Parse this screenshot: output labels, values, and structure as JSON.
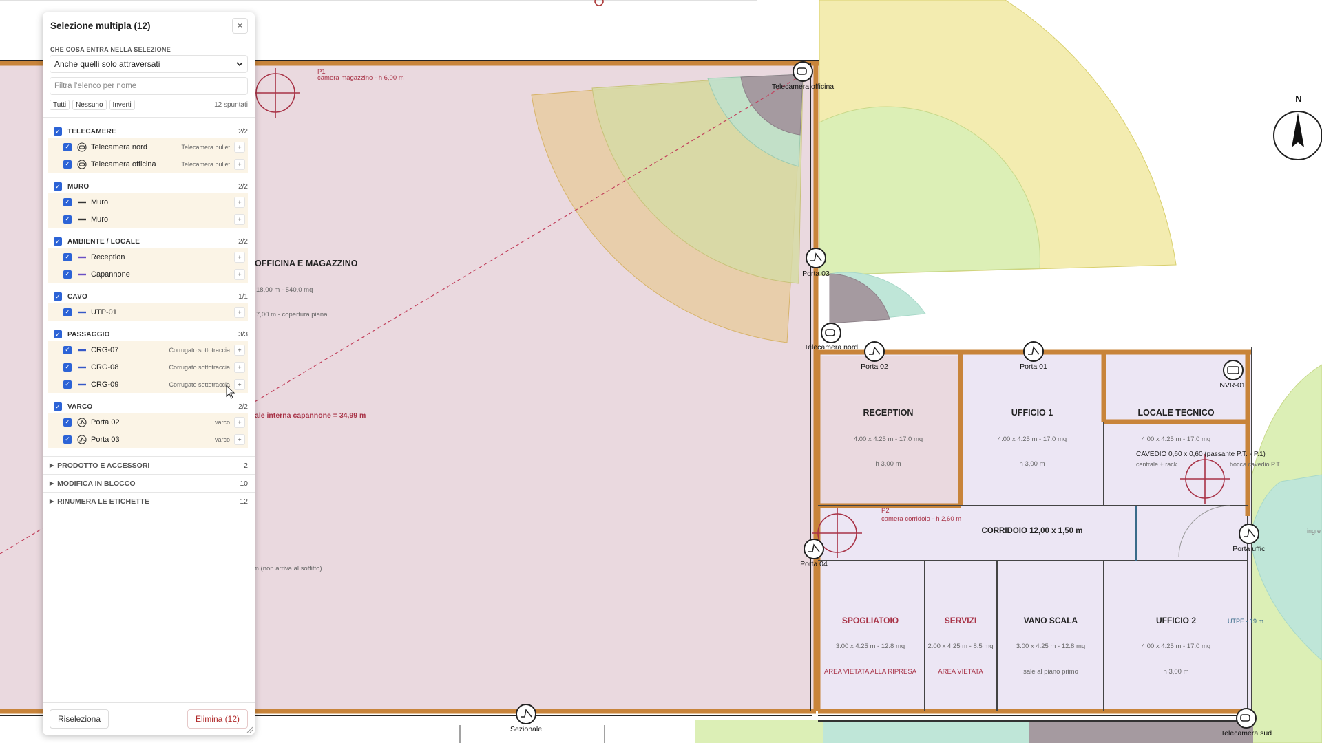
{
  "panel": {
    "title": "Selezione multipla (12)",
    "close_label": "×",
    "mode_label": "CHE COSA ENTRA NELLA SELEZIONE",
    "mode_value": "Anche quelli solo attraversati",
    "filter_placeholder": "Filtra l'elenco per nome",
    "btn_all": "Tutti",
    "btn_none": "Nessuno",
    "btn_invert": "Inverti",
    "checked_count": "12 spuntati",
    "groups": [
      {
        "name": "TELECAMERE",
        "count": "2/2",
        "items": [
          {
            "label": "Telecamera nord",
            "sub": "Telecamera bullet",
            "icon": "camera-icon"
          },
          {
            "label": "Telecamera officina",
            "sub": "Telecamera bullet",
            "icon": "camera-icon"
          }
        ]
      },
      {
        "name": "MURO",
        "count": "2/2",
        "items": [
          {
            "label": "Muro",
            "sub": "",
            "icon": "wall-line-icon"
          },
          {
            "label": "Muro",
            "sub": "",
            "icon": "wall-line-icon"
          }
        ]
      },
      {
        "name": "AMBIENTE / LOCALE",
        "count": "2/2",
        "items": [
          {
            "label": "Reception",
            "sub": "",
            "icon": "room-line-icon"
          },
          {
            "label": "Capannone",
            "sub": "",
            "icon": "room-line-icon"
          }
        ]
      },
      {
        "name": "CAVO",
        "count": "1/1",
        "items": [
          {
            "label": "UTP-01",
            "sub": "",
            "icon": "cable-line-icon"
          }
        ]
      },
      {
        "name": "PASSAGGIO",
        "count": "3/3",
        "items": [
          {
            "label": "CRG-07",
            "sub": "Corrugato sottotraccia",
            "icon": "conduit-line-icon"
          },
          {
            "label": "CRG-08",
            "sub": "Corrugato sottotraccia",
            "icon": "conduit-line-icon"
          },
          {
            "label": "CRG-09",
            "sub": "Corrugato sottotraccia",
            "icon": "conduit-line-icon"
          }
        ]
      },
      {
        "name": "VARCO",
        "count": "2/2",
        "items": [
          {
            "label": "Porta 02",
            "sub": "varco",
            "icon": "door-icon"
          },
          {
            "label": "Porta 03",
            "sub": "varco",
            "icon": "door-icon"
          }
        ]
      }
    ],
    "collapsed": [
      {
        "label": "PRODOTTO E ACCESSORI",
        "count": "2"
      },
      {
        "label": "MODIFICA IN BLOCCO",
        "count": "10"
      },
      {
        "label": "RINUMERA LE ETICHETTE",
        "count": "12"
      }
    ],
    "footer": {
      "reselect": "Riseleziona",
      "delete": "Elimina (12)"
    }
  },
  "plan": {
    "cameras": [
      {
        "label": "Telecamera officina"
      },
      {
        "label": "Telecamera nord"
      },
      {
        "label": "Telecamera sud"
      }
    ],
    "doors": [
      {
        "label": "Porta 03"
      },
      {
        "label": "Porta 02"
      },
      {
        "label": "Porta 01"
      },
      {
        "label": "Porta 04"
      },
      {
        "label": "Porta uffici"
      },
      {
        "label": "Sezionale"
      }
    ],
    "nvr": "NVR-01",
    "north": "N",
    "warehouse": {
      "name": "OFFICINA E MAGAZZINO",
      "dims": "18,00 m  -  540,0 mq",
      "height": "7,00 m  -  copertura piana",
      "camera_note": "camera magazzino - h 6,00 m",
      "p1": "P1",
      "measure": "ale interna capannone = 34,99 m",
      "wall_note": "m  (non arriva al soffitto)"
    },
    "rooms": [
      {
        "name": "RECEPTION",
        "dims": "4.00 x 4.25 m  -  17.0 mq",
        "note": "h 3,00 m"
      },
      {
        "name": "UFFICIO 1",
        "dims": "4.00 x 4.25 m  -  17.0 mq",
        "note": "h 3,00 m"
      },
      {
        "name": "LOCALE TECNICO",
        "dims": "4.00 x 4.25 m  -  17.0 mq",
        "note": ""
      },
      {
        "name": "CORRIDOIO  12,00 x 1,50 m",
        "dims": "",
        "note": ""
      },
      {
        "name": "SPOGLIATOIO",
        "dims": "3.00 x 4.25 m  -  12.8 mq",
        "note": "AREA VIETATA ALLA RIPRESA"
      },
      {
        "name": "SERVIZI",
        "dims": "2.00 x 4.25 m  -  8.5 mq",
        "note": "AREA VIETATA"
      },
      {
        "name": "VANO SCALA",
        "dims": "3.00 x 4.25 m  -  12.8 mq",
        "note": "sale al piano primo"
      },
      {
        "name": "UFFICIO 2",
        "dims": "4.00 x 4.25 m  -  17.0 mq",
        "note": "h 3,00 m"
      }
    ],
    "cavedio": "CAVEDIO 0,60 x 0,60  (passante P.T. - P.1)",
    "cavedio_sub": "centrale + rack",
    "cavedio_side": "bocca cavedio P.T.",
    "p2": "P2",
    "camera_corridor": "camera corridoio - h 2,60 m",
    "utpe": "UTPE - 19 m",
    "ingresso": "ingre",
    "colors": {
      "wall": "#c8843a",
      "warehouse": "#ead9df",
      "office": "#ece6f4",
      "cone_yellow": "#f3ecb0",
      "cone_green": "#dcefb6",
      "accent": "#2c63d6"
    }
  }
}
